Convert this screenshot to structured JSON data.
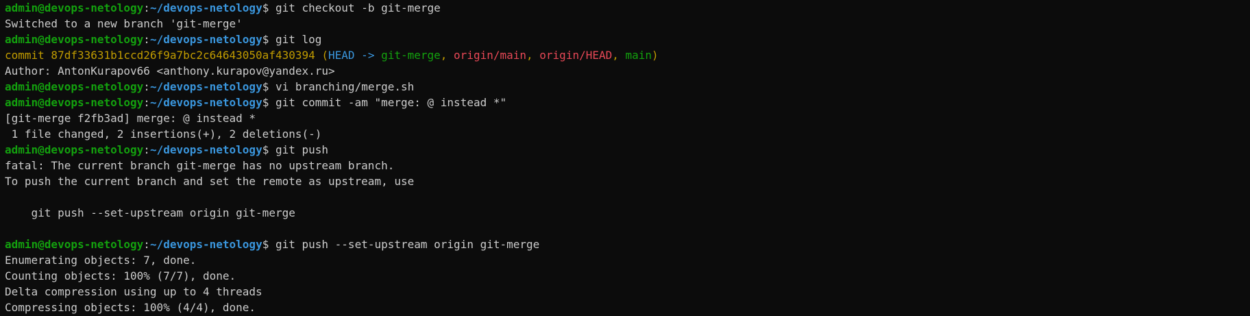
{
  "prompt": {
    "user_host": "admin@devops-netology",
    "colon": ":",
    "path": "~/devops-netology",
    "dollar": "$ "
  },
  "colors": {
    "default": "#cccccc",
    "yellow": "#c19c00",
    "cyan": "#3a96dd",
    "green": "#13a10e",
    "red": "#e74856"
  },
  "lines": [
    {
      "type": "prompt",
      "cmd": "git checkout -b git-merge"
    },
    {
      "type": "output",
      "segments": [
        {
          "text": "Switched to a new branch 'git-merge'",
          "color": "default"
        }
      ]
    },
    {
      "type": "prompt",
      "cmd": "git log"
    },
    {
      "type": "output",
      "segments": [
        {
          "text": "commit 87df33631b1ccd26f9a7bc2c64643050af430394 (",
          "color": "yellow"
        },
        {
          "text": "HEAD -> ",
          "color": "cyan"
        },
        {
          "text": "git-merge",
          "color": "green"
        },
        {
          "text": ", ",
          "color": "yellow"
        },
        {
          "text": "origin/main",
          "color": "red"
        },
        {
          "text": ", ",
          "color": "yellow"
        },
        {
          "text": "origin/HEAD",
          "color": "red"
        },
        {
          "text": ", ",
          "color": "yellow"
        },
        {
          "text": "main",
          "color": "green"
        },
        {
          "text": ")",
          "color": "yellow"
        }
      ]
    },
    {
      "type": "output",
      "segments": [
        {
          "text": "Author: AntonKurapov66 <anthony.kurapov@yandex.ru>",
          "color": "default"
        }
      ]
    },
    {
      "type": "prompt",
      "cmd": "vi branching/merge.sh"
    },
    {
      "type": "prompt",
      "cmd": "git commit -am \"merge: @ instead *\""
    },
    {
      "type": "output",
      "segments": [
        {
          "text": "[git-merge f2fb3ad] merge: @ instead *",
          "color": "default"
        }
      ]
    },
    {
      "type": "output",
      "segments": [
        {
          "text": " 1 file changed, 2 insertions(+), 2 deletions(-)",
          "color": "default"
        }
      ]
    },
    {
      "type": "prompt",
      "cmd": "git push"
    },
    {
      "type": "output",
      "segments": [
        {
          "text": "fatal: The current branch git-merge has no upstream branch.",
          "color": "default"
        }
      ]
    },
    {
      "type": "output",
      "segments": [
        {
          "text": "To push the current branch and set the remote as upstream, use",
          "color": "default"
        }
      ]
    },
    {
      "type": "output",
      "segments": [
        {
          "text": "",
          "color": "default"
        }
      ]
    },
    {
      "type": "output",
      "segments": [
        {
          "text": "    git push --set-upstream origin git-merge",
          "color": "default"
        }
      ]
    },
    {
      "type": "output",
      "segments": [
        {
          "text": "",
          "color": "default"
        }
      ]
    },
    {
      "type": "prompt",
      "cmd": "git push --set-upstream origin git-merge"
    },
    {
      "type": "output",
      "segments": [
        {
          "text": "Enumerating objects: 7, done.",
          "color": "default"
        }
      ]
    },
    {
      "type": "output",
      "segments": [
        {
          "text": "Counting objects: 100% (7/7), done.",
          "color": "default"
        }
      ]
    },
    {
      "type": "output",
      "segments": [
        {
          "text": "Delta compression using up to 4 threads",
          "color": "default"
        }
      ]
    },
    {
      "type": "output",
      "segments": [
        {
          "text": "Compressing objects: 100% (4/4), done.",
          "color": "default"
        }
      ]
    }
  ]
}
